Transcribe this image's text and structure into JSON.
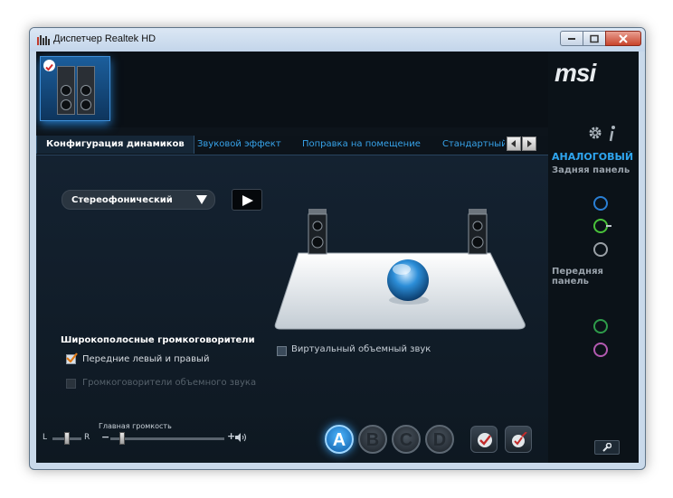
{
  "window": {
    "title": "Диспетчер Realtek HD"
  },
  "brand": {
    "logo": "msi",
    "accent": "#37a3ea"
  },
  "tabs": [
    {
      "label": "Конфигурация динамиков",
      "active": true
    },
    {
      "label": "Звуковой эффект",
      "active": false
    },
    {
      "label": "Поправка на помещение",
      "active": false
    },
    {
      "label": "Стандартный ф",
      "active": false
    }
  ],
  "config": {
    "dropdown_value": "Стереофонический",
    "fullrange_heading": "Широкополосные громкоговорители",
    "front_lr": {
      "label": "Передние левый и правый",
      "checked": true,
      "enabled": true
    },
    "surround": {
      "label": "Громкоговорители объемного звука",
      "checked": false,
      "enabled": false
    },
    "virtual_surround": {
      "label": "Виртуальный объемный звук",
      "checked": false
    }
  },
  "volume": {
    "balance_left": "L",
    "balance_right": "R",
    "main_label": "Главная громкость",
    "minus": "−",
    "plus": "+",
    "balance_level": 0.5,
    "main_level": 0.1
  },
  "mode_buttons": [
    "A",
    "B",
    "C",
    "D"
  ],
  "active_mode": "A",
  "right_panel": {
    "analog_label": "АНАЛОГОВЫЙ",
    "rear_panel_label": "Задняя панель",
    "front_panel_label": "Передняя панель",
    "rear_jacks": [
      "#2a7fd4",
      "#49c23a",
      "#9aa0a6"
    ],
    "front_jacks": [
      "#2e9c4a",
      "#b35ab0"
    ]
  },
  "icons": {
    "gear": "gear-icon",
    "info": "info-icon",
    "wrench": "wrench-icon",
    "play": "play-icon"
  }
}
